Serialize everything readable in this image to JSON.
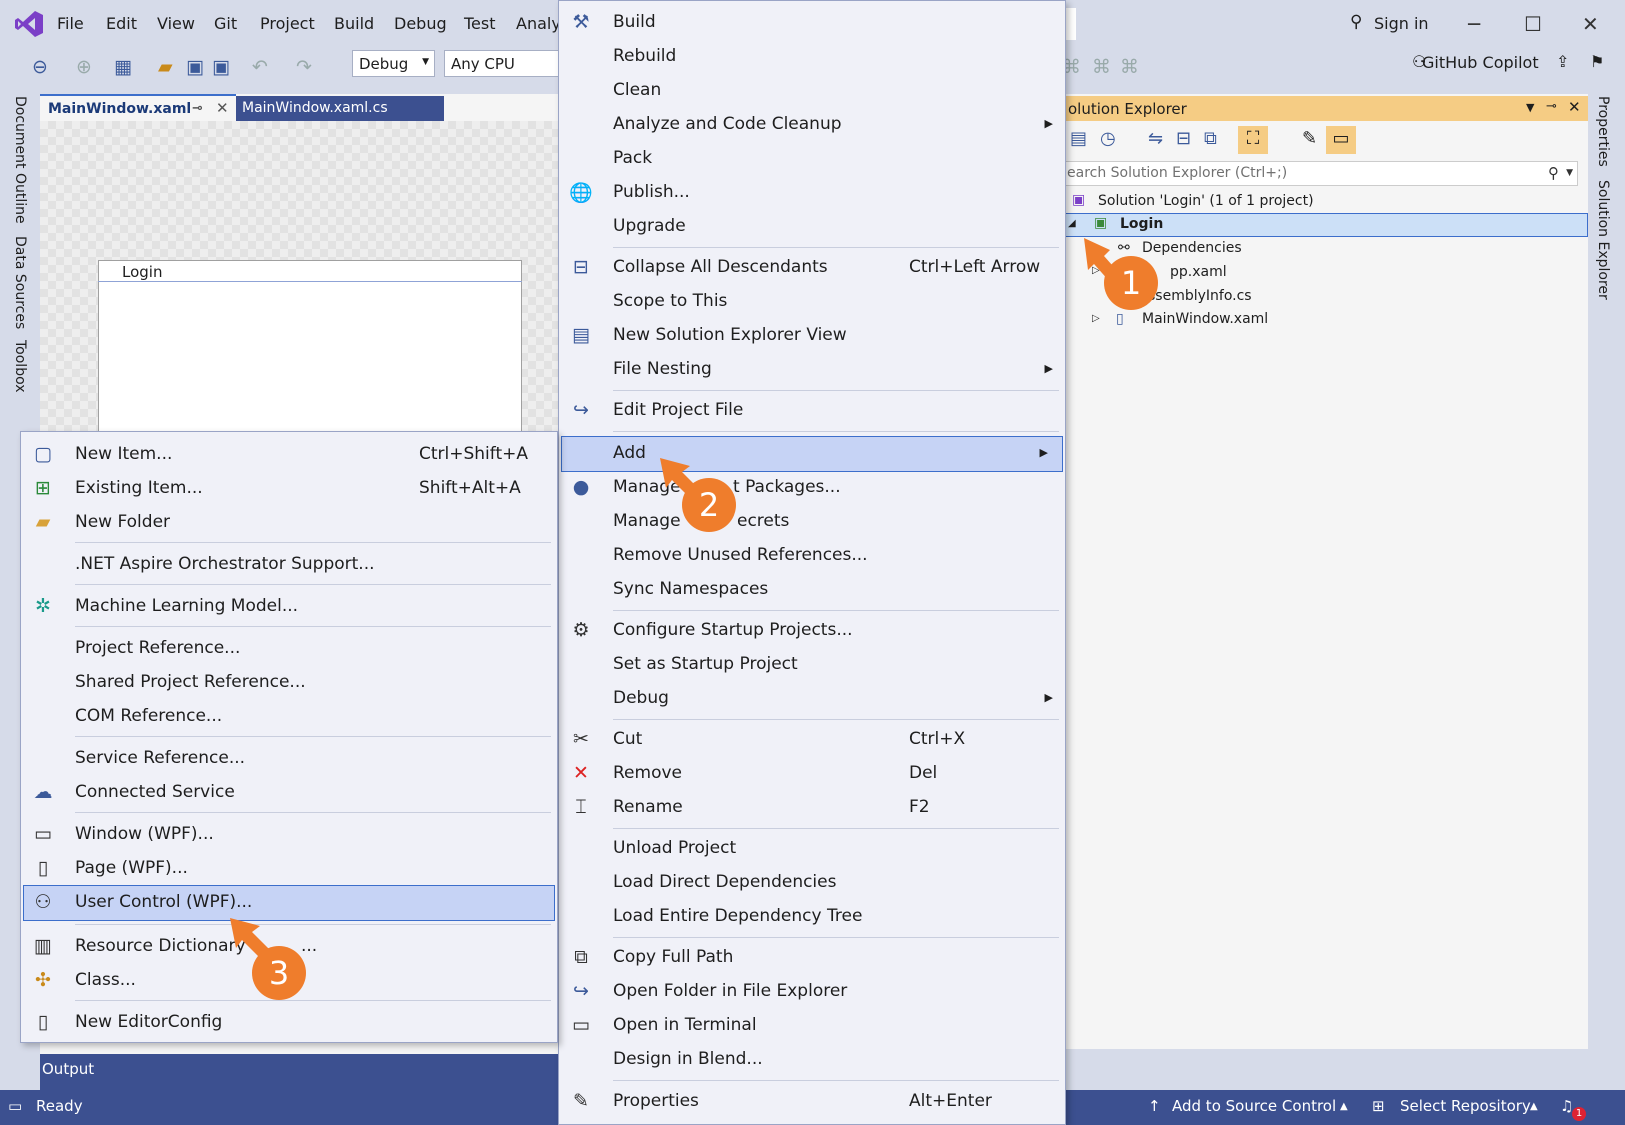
{
  "menubar": {
    "items": [
      "File",
      "Edit",
      "View",
      "Git",
      "Project",
      "Build",
      "Debug",
      "Test",
      "Analyz"
    ],
    "sign_in": "Sign in",
    "copilot": "GitHub Copilot"
  },
  "toolbar": {
    "config": "Debug",
    "platform": "Any CPU"
  },
  "left_tabs": [
    "Document Outline",
    "Data Sources",
    "Toolbox"
  ],
  "doc_tabs": [
    {
      "label": "MainWindow.xaml",
      "active": true
    },
    {
      "label": "MainWindow.xaml.cs",
      "active": false
    }
  ],
  "designer": {
    "window_title": "Login"
  },
  "solution_explorer": {
    "title": "olution Explorer",
    "search_placeholder": "earch Solution Explorer (Ctrl+;)",
    "tree": [
      {
        "label": "Solution 'Login' (1 of 1 project)"
      },
      {
        "label": "Login"
      },
      {
        "label": "Dependencies"
      },
      {
        "label": "pp.xaml"
      },
      {
        "label": "ssemblyInfo.cs"
      },
      {
        "label": "MainWindow.xaml"
      }
    ]
  },
  "right_tabs": [
    "Properties",
    "Solution Explorer"
  ],
  "context_menu": {
    "items": [
      {
        "label": "Build",
        "shortcut": ""
      },
      {
        "label": "Rebuild",
        "shortcut": ""
      },
      {
        "label": "Clean",
        "shortcut": ""
      },
      {
        "label": "Analyze and Code Cleanup",
        "shortcut": ""
      },
      {
        "label": "Pack",
        "shortcut": ""
      },
      {
        "label": "Publish...",
        "shortcut": ""
      },
      {
        "label": "Upgrade",
        "shortcut": ""
      },
      {
        "label": "Collapse All Descendants",
        "shortcut": "Ctrl+Left Arrow"
      },
      {
        "label": "Scope to This",
        "shortcut": ""
      },
      {
        "label": "New Solution Explorer View",
        "shortcut": ""
      },
      {
        "label": "File Nesting",
        "shortcut": ""
      },
      {
        "label": "Edit Project File",
        "shortcut": ""
      },
      {
        "label": "Add",
        "shortcut": ""
      },
      {
        "label": "Manage",
        "shortcut": ""
      },
      {
        "label": "t Packages...",
        "shortcut": ""
      },
      {
        "label": "Manage",
        "shortcut": ""
      },
      {
        "label": "ecrets",
        "shortcut": ""
      },
      {
        "label": "Remove Unused References...",
        "shortcut": ""
      },
      {
        "label": "Sync Namespaces",
        "shortcut": ""
      },
      {
        "label": "Configure Startup Projects...",
        "shortcut": ""
      },
      {
        "label": "Set as Startup Project",
        "shortcut": ""
      },
      {
        "label": "Debug",
        "shortcut": ""
      },
      {
        "label": "Cut",
        "shortcut": "Ctrl+X"
      },
      {
        "label": "Remove",
        "shortcut": "Del"
      },
      {
        "label": "Rename",
        "shortcut": "F2"
      },
      {
        "label": "Unload Project",
        "shortcut": ""
      },
      {
        "label": "Load Direct Dependencies",
        "shortcut": ""
      },
      {
        "label": "Load Entire Dependency Tree",
        "shortcut": ""
      },
      {
        "label": "Copy Full Path",
        "shortcut": ""
      },
      {
        "label": "Open Folder in File Explorer",
        "shortcut": ""
      },
      {
        "label": "Open in Terminal",
        "shortcut": ""
      },
      {
        "label": "Design in Blend...",
        "shortcut": ""
      },
      {
        "label": "Properties",
        "shortcut": "Alt+Enter"
      }
    ]
  },
  "add_submenu": {
    "items": [
      {
        "label": "New Item...",
        "shortcut": "Ctrl+Shift+A"
      },
      {
        "label": "Existing Item...",
        "shortcut": "Shift+Alt+A"
      },
      {
        "label": "New Folder",
        "shortcut": ""
      },
      {
        "label": ".NET Aspire Orchestrator Support...",
        "shortcut": ""
      },
      {
        "label": "Machine Learning Model...",
        "shortcut": ""
      },
      {
        "label": "Project Reference...",
        "shortcut": ""
      },
      {
        "label": "Shared Project Reference...",
        "shortcut": ""
      },
      {
        "label": "COM Reference...",
        "shortcut": ""
      },
      {
        "label": "Service Reference...",
        "shortcut": ""
      },
      {
        "label": "Connected Service",
        "shortcut": ""
      },
      {
        "label": "Window (WPF)...",
        "shortcut": ""
      },
      {
        "label": "Page (WPF)...",
        "shortcut": ""
      },
      {
        "label": "User Control (WPF)...",
        "shortcut": ""
      },
      {
        "label": "Resource Dictionary",
        "shortcut": ""
      },
      {
        "label": "...",
        "shortcut": ""
      },
      {
        "label": "Class...",
        "shortcut": ""
      },
      {
        "label": "New EditorConfig",
        "shortcut": ""
      }
    ]
  },
  "output_tab": "Output",
  "status": {
    "ready": "Ready",
    "source_control": "Add to Source Control",
    "repository": "Select Repository",
    "notifications": "1"
  },
  "callouts": [
    "1",
    "2",
    "3"
  ],
  "colors": {
    "accent": "#3c5090",
    "callout": "#ef7d2c",
    "highlight": "#c6d3f5"
  }
}
